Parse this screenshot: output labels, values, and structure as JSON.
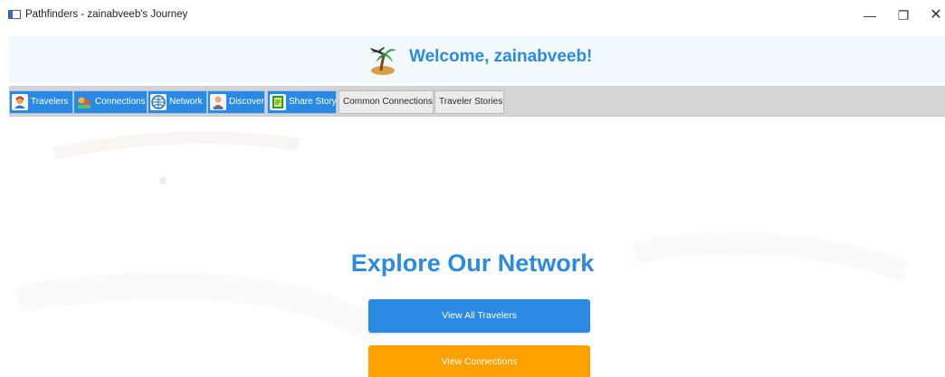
{
  "window": {
    "title": "Pathfinders - zainabveeb's Journey",
    "controls": {
      "minimize": "—",
      "maximize": "❐",
      "close": "✕"
    }
  },
  "header": {
    "welcome_text": "Welcome, zainabveeb!",
    "brand_icon": "palm-tree-airplane-icon"
  },
  "tabs": [
    {
      "label": "Travelers",
      "icon": "travelers-icon",
      "style": "blue"
    },
    {
      "label": "Connections",
      "icon": "connections-icon",
      "style": "blue"
    },
    {
      "label": "Network",
      "icon": "network-icon",
      "style": "blue"
    },
    {
      "label": "Discover",
      "icon": "discover-icon",
      "style": "blue"
    },
    {
      "label": "Share Story",
      "icon": "share-story-icon",
      "style": "blue"
    },
    {
      "label": "Common Connections",
      "style": "plain"
    },
    {
      "label": "Traveler Stories",
      "style": "plain"
    }
  ],
  "main": {
    "title": "Explore Our Network",
    "buttons": [
      {
        "label": "View All Travelers",
        "color": "#2a8ae3"
      },
      {
        "label": "View Connections",
        "color": "#fda100"
      }
    ]
  },
  "colors": {
    "accent_blue": "#2b8be0",
    "button_orange": "#fda100",
    "tab_blue": "#2a8ae3",
    "tabbar_gray": "#d4d4d4",
    "header_bg": "#f2f9ff"
  }
}
